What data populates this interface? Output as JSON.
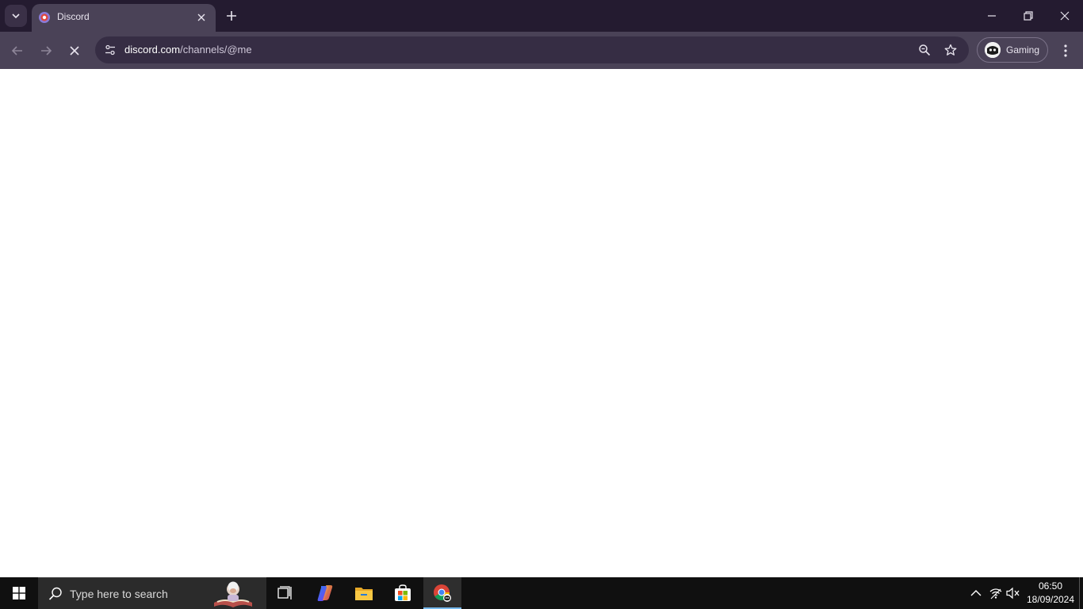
{
  "browser": {
    "tab": {
      "title": "Discord"
    },
    "omnibox": {
      "host": "discord.com",
      "path": "/channels/@me"
    },
    "profile": {
      "name": "Gaming"
    }
  },
  "taskbar": {
    "search_placeholder": "Type here to search",
    "clock": {
      "time": "06:50",
      "date": "18/09/2024"
    }
  },
  "icons": {
    "tab_search": "chevron-down-icon",
    "favicon": "discord-favicon",
    "tab_close": "close-icon",
    "new_tab": "plus-icon",
    "back": "arrow-left-icon",
    "forward": "arrow-right-icon",
    "stop": "close-icon",
    "zoom": "zoom-icon",
    "bookmark": "star-icon",
    "menu": "kebab-icon"
  },
  "colors": {
    "tabstrip": "#241b30",
    "toolbar": "#4a4257",
    "omnibox": "#362d44",
    "taskbar": "#101010",
    "content": "#ffffff"
  }
}
